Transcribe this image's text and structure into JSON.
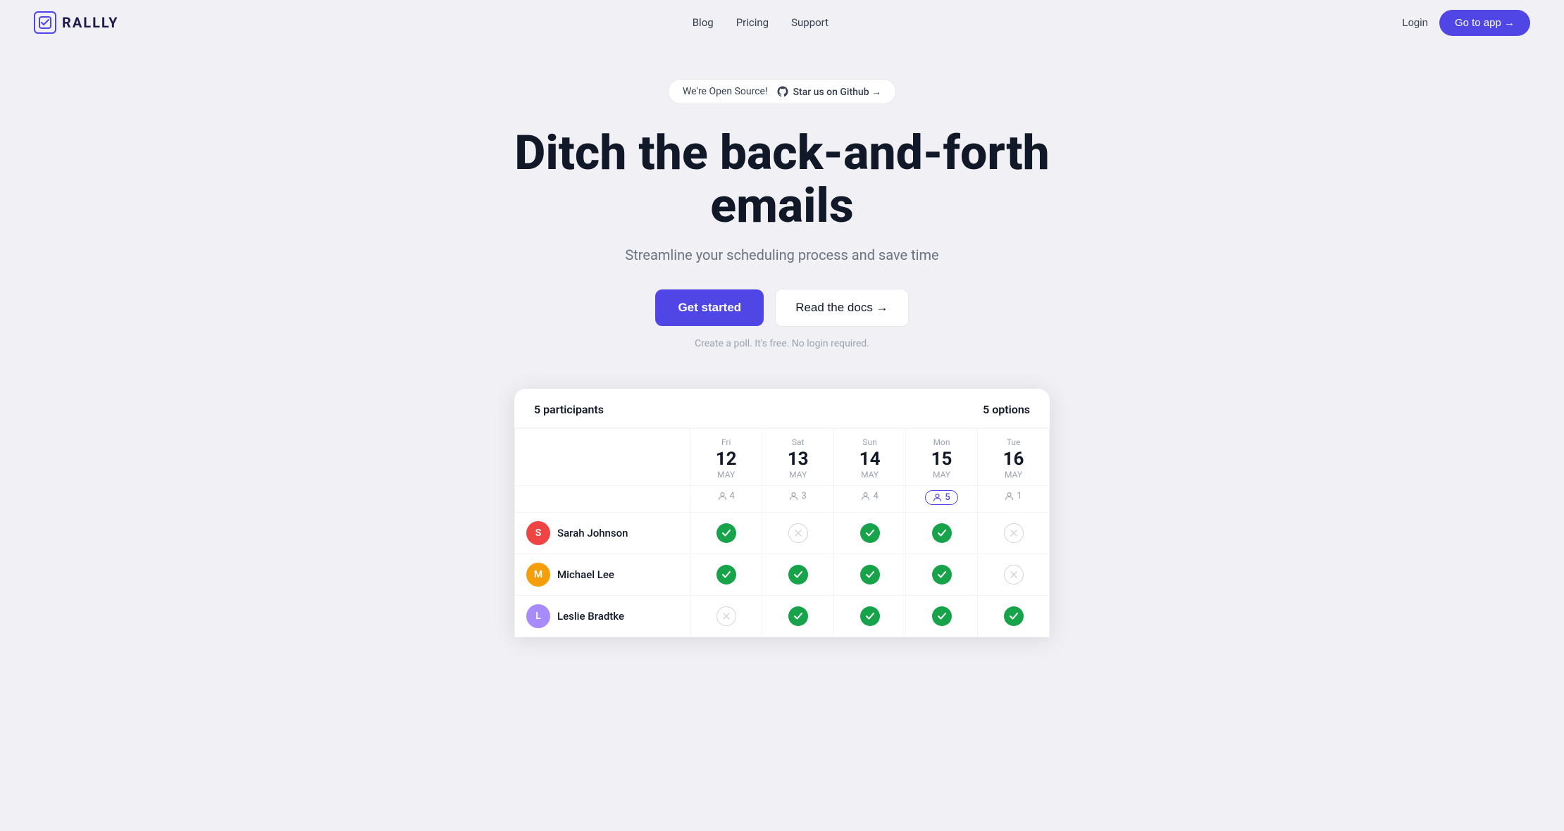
{
  "navbar": {
    "logo_text": "RALLLY",
    "links": [
      {
        "label": "Blog",
        "id": "blog"
      },
      {
        "label": "Pricing",
        "id": "pricing"
      },
      {
        "label": "Support",
        "id": "support"
      }
    ],
    "login_label": "Login",
    "goto_app_label": "Go to app →"
  },
  "hero": {
    "badge_open_source": "We're Open Source!",
    "badge_github": "Star us on Github →",
    "title": "Ditch the back-and-forth emails",
    "subtitle": "Streamline your scheduling process and save time",
    "get_started_label": "Get started",
    "read_docs_label": "Read the docs →",
    "note": "Create a poll. It's free. No login required."
  },
  "demo": {
    "participants_label": "5 participants",
    "options_label": "5 options",
    "columns": [
      {
        "day": "Fri",
        "date": "12",
        "month": "MAY",
        "votes": 4,
        "highlight": false
      },
      {
        "day": "Sat",
        "date": "13",
        "month": "MAY",
        "votes": 3,
        "highlight": false
      },
      {
        "day": "Sun",
        "date": "14",
        "month": "MAY",
        "votes": 4,
        "highlight": false
      },
      {
        "day": "Mon",
        "date": "15",
        "month": "MAY",
        "votes": 5,
        "highlight": true
      },
      {
        "day": "Tue",
        "date": "16",
        "month": "MAY",
        "votes": 1,
        "highlight": false
      }
    ],
    "participants": [
      {
        "name": "Sarah Johnson",
        "initial": "S",
        "color": "#ef4444",
        "votes": [
          true,
          false,
          true,
          true,
          false
        ]
      },
      {
        "name": "Michael Lee",
        "initial": "M",
        "color": "#f59e0b",
        "votes": [
          true,
          true,
          true,
          true,
          false
        ]
      },
      {
        "name": "Leslie Bradtke",
        "initial": "L",
        "color": "#a78bfa",
        "votes": [
          false,
          true,
          true,
          true,
          true
        ]
      }
    ]
  },
  "icons": {
    "check": "✓",
    "x": "✕",
    "arrow_right": "→",
    "person": "👤"
  },
  "colors": {
    "brand": "#4f46e5",
    "green": "#16a34a",
    "gray_border": "#d1d5db"
  }
}
